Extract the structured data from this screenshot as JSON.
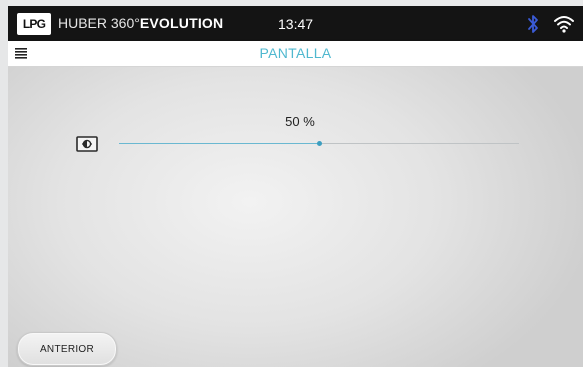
{
  "status_bar": {
    "logo_text": "LPG",
    "brand_prefix": "HUBER 360°",
    "brand_suffix": "EVOLUTION",
    "time": "13:47",
    "bluetooth_color": "#3b5bd6",
    "icons": [
      "bluetooth-icon",
      "wifi-icon"
    ]
  },
  "title_bar": {
    "menu_icon": "hamburger-menu-icon",
    "title": "PANTALLA",
    "accent_color": "#4fb8cf"
  },
  "brightness": {
    "icon": "brightness-icon",
    "value_label": "50 %",
    "value_fraction": 0.5
  },
  "footer": {
    "back_label": "ANTERIOR"
  }
}
